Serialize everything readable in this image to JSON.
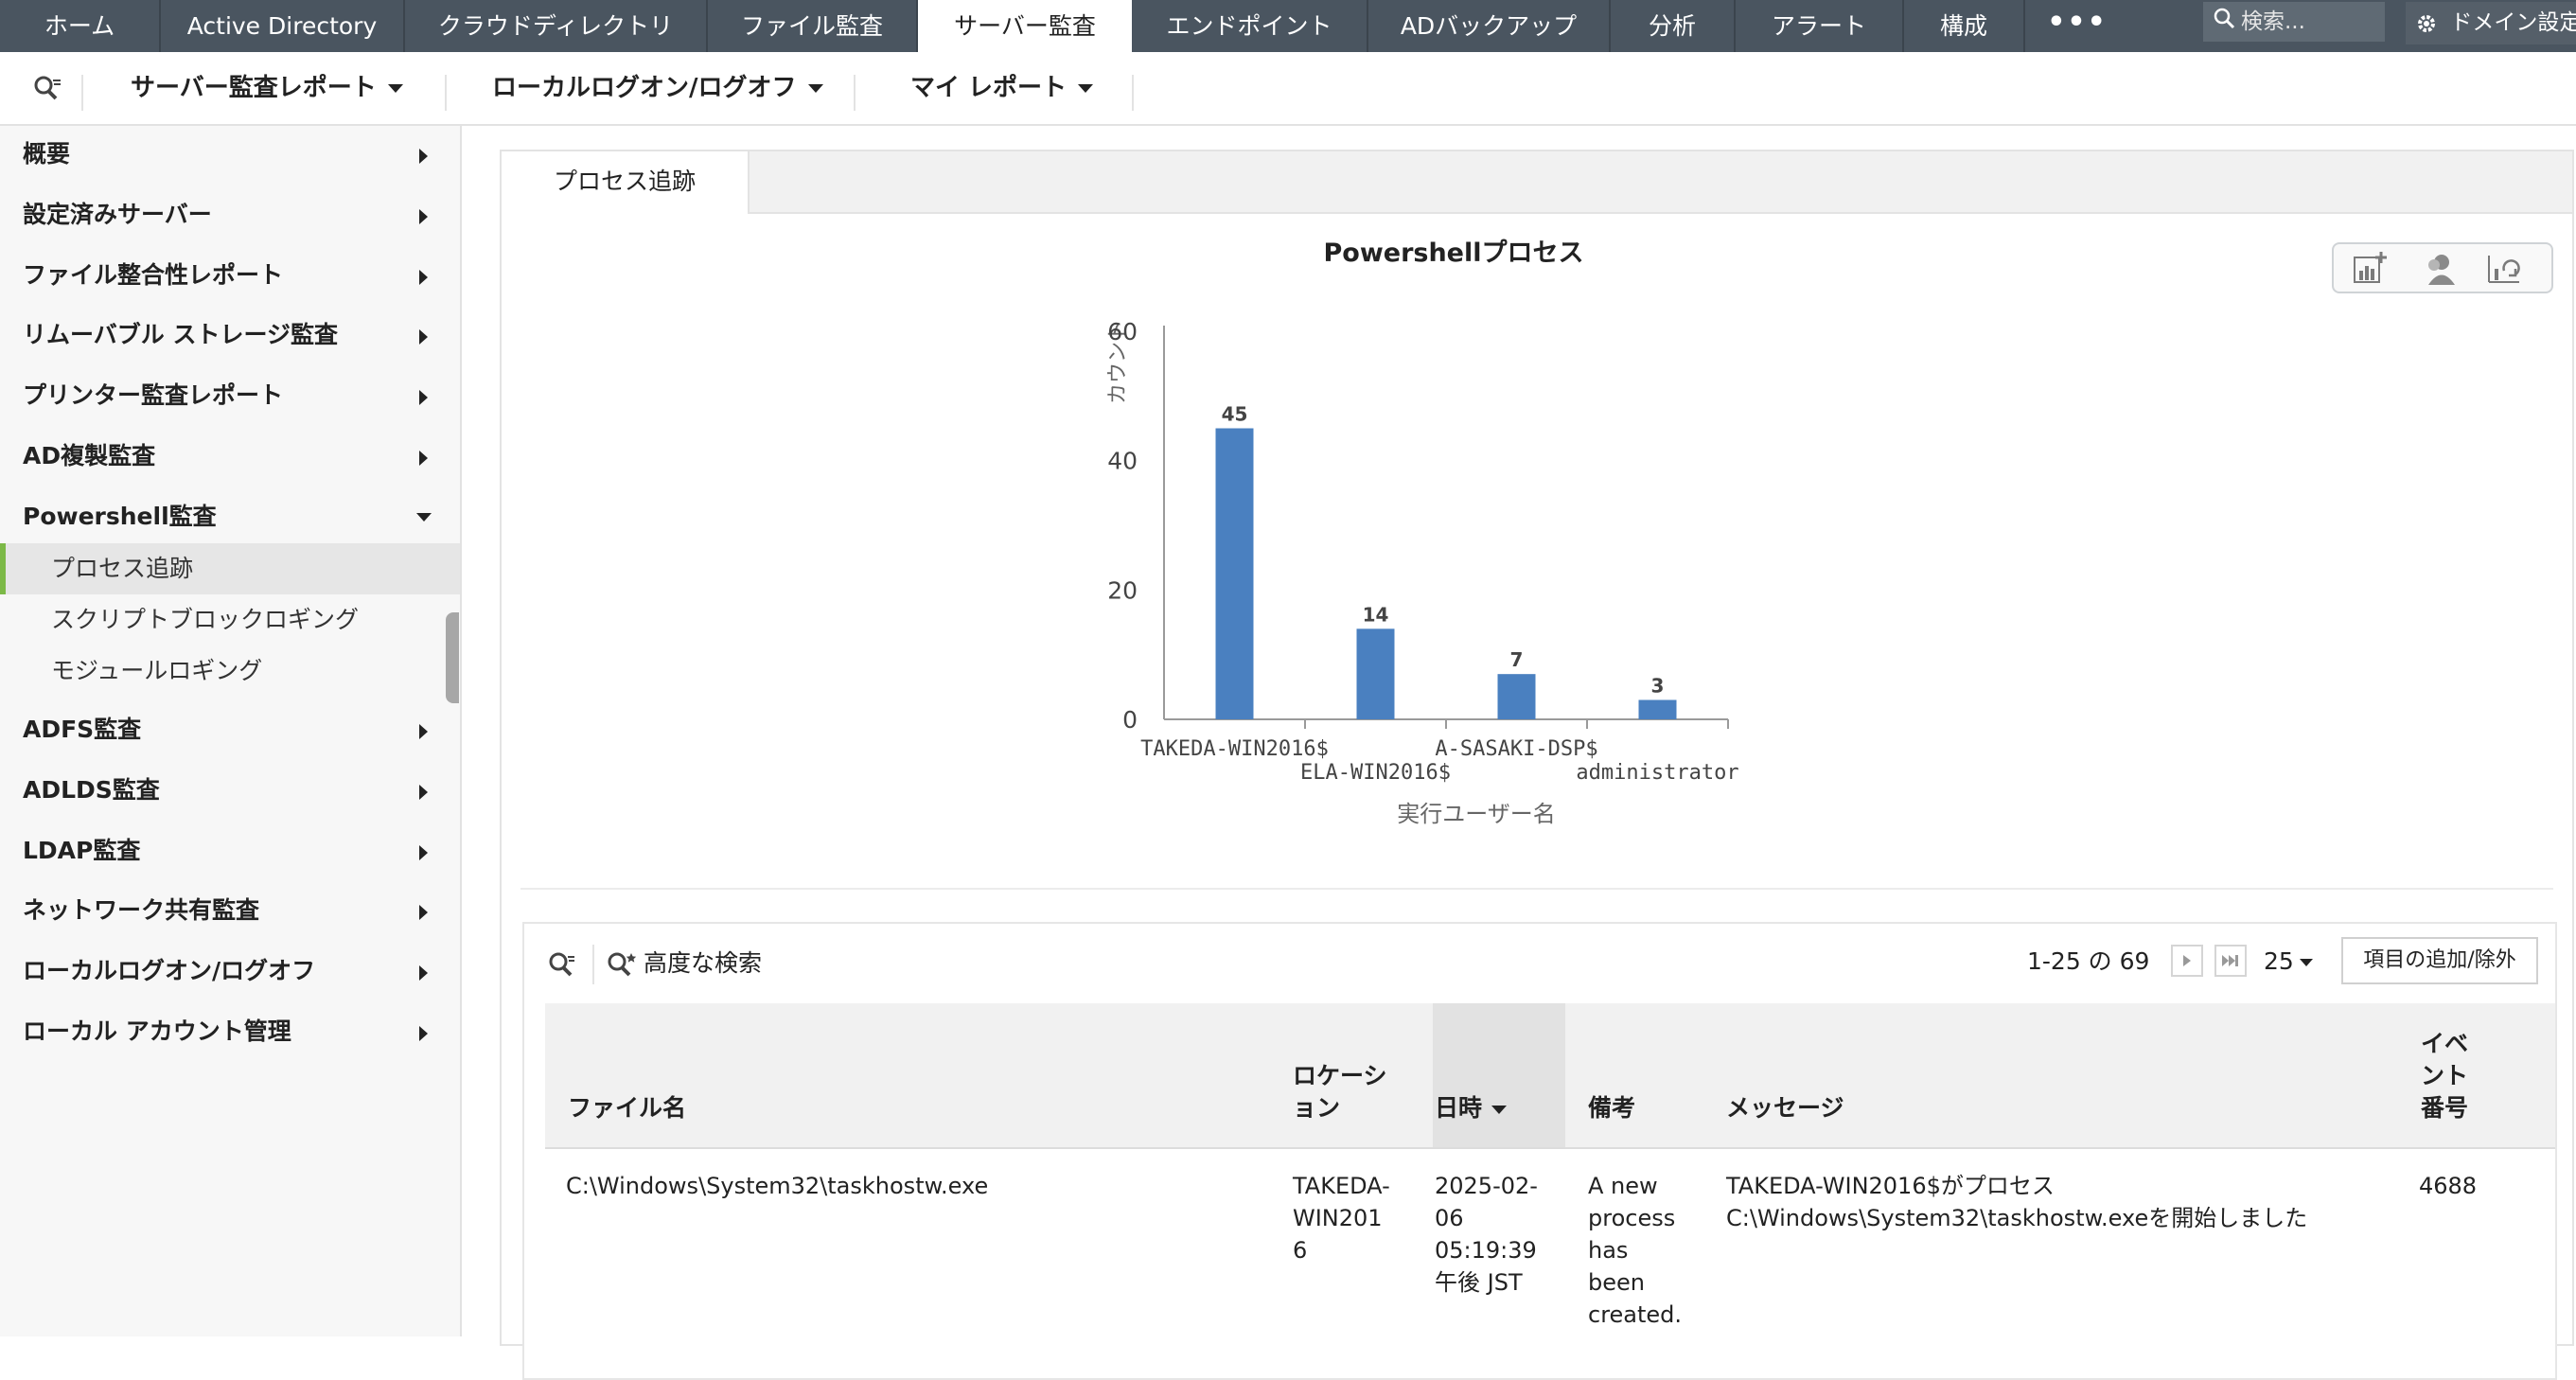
{
  "nav": {
    "tabs": [
      {
        "label": "ホーム",
        "active": false
      },
      {
        "label": "Active Directory",
        "active": false
      },
      {
        "label": "クラウドディレクトリ",
        "active": false
      },
      {
        "label": "ファイル監査",
        "active": false
      },
      {
        "label": "サーバー監査",
        "active": true
      },
      {
        "label": "エンドポイント",
        "active": false
      },
      {
        "label": "ADバックアップ",
        "active": false
      },
      {
        "label": "分析",
        "active": false
      },
      {
        "label": "アラート",
        "active": false
      },
      {
        "label": "構成",
        "active": false
      }
    ],
    "more_label": "•••",
    "search_placeholder": "検索...",
    "domain_settings": "ドメイン設定"
  },
  "toolbar": {
    "server_audit_reports": "サーバー監査レポート",
    "local_logon": "ローカルログオン/ログオフ",
    "my_reports": "マイ レポート"
  },
  "sidebar": {
    "items": [
      {
        "label": "概要"
      },
      {
        "label": "設定済みサーバー"
      },
      {
        "label": "ファイル整合性レポート"
      },
      {
        "label": "リムーバブル ストレージ監査"
      },
      {
        "label": "プリンター監査レポート"
      },
      {
        "label": "AD複製監査"
      },
      {
        "label": "Powershell監査",
        "expanded": true
      },
      {
        "label": "ADFS監査"
      },
      {
        "label": "ADLDS監査"
      },
      {
        "label": "LDAP監査"
      },
      {
        "label": "ネットワーク共有監査"
      },
      {
        "label": "ローカルログオン/ログオフ"
      },
      {
        "label": "ローカル アカウント管理"
      }
    ],
    "subitems": [
      {
        "label": "プロセス追跡",
        "selected": true
      },
      {
        "label": "スクリプトブロックロギング",
        "selected": false
      },
      {
        "label": "モジュールロギング",
        "selected": false
      }
    ]
  },
  "content": {
    "tab_label": "プロセス追跡"
  },
  "chart_data": {
    "type": "bar",
    "title": "Powershellプロセス",
    "xlabel": "実行ユーザー名",
    "ylabel": "カウント",
    "categories": [
      "TAKEDA-WIN2016$",
      "ELA-WIN2016$",
      "A-SASAKI-DSP$",
      "administrator"
    ],
    "values": [
      45,
      14,
      7,
      3
    ],
    "ylim": [
      0,
      60
    ],
    "yticks": [
      0,
      20,
      40,
      60
    ],
    "grid": false,
    "bar_color": "#4a80c0"
  },
  "grid": {
    "advanced_search": "高度な検索",
    "pager": "1-25 の 69",
    "page_size": "25",
    "add_remove": "項目の追加/除外",
    "columns": {
      "file_name": "ファイル名",
      "location": "ロケーション",
      "datetime": "日時",
      "remarks": "備考",
      "message": "メッセージ",
      "event_no": "イベント番号"
    },
    "rows": [
      {
        "file_name": "C:\\Windows\\System32\\taskhostw.exe",
        "location": "TAKEDA-WIN2016",
        "datetime": "2025-02-06 05:19:39 午後 JST",
        "remarks": "A new process has been created.",
        "message": "TAKEDA-WIN2016$がプロセス C:\\Windows\\System32\\taskhostw.exeを開始しました",
        "event_no": "4688"
      }
    ]
  },
  "colors": {
    "nav_bg": "#4a5560",
    "accent_green": "#7cb947"
  }
}
